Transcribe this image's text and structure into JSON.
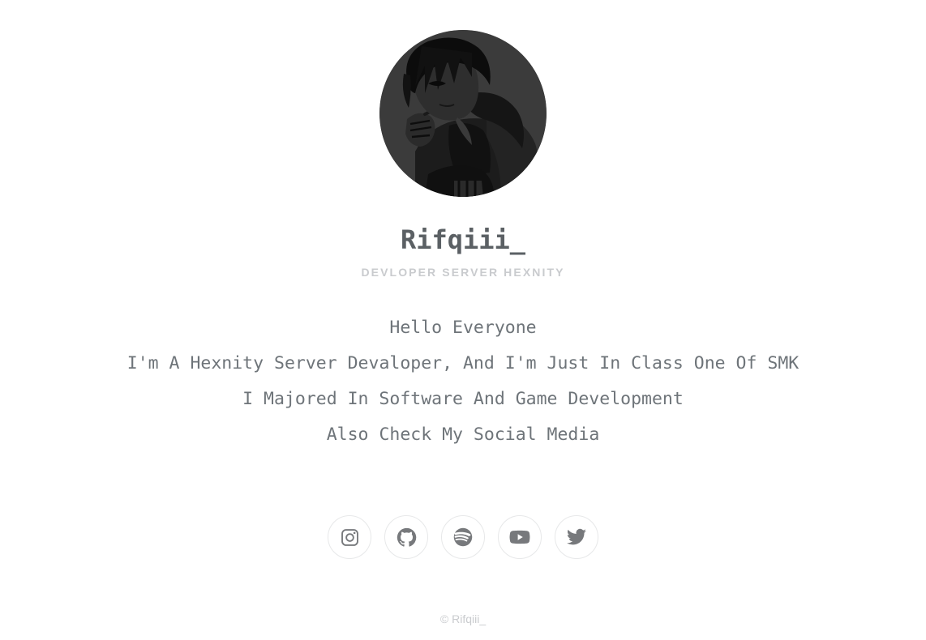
{
  "profile": {
    "avatar_alt": "avatar-anime-boy-dark",
    "name": "Rifqiii_",
    "subtitle": "DEVLOPER SERVER HEXNITY"
  },
  "bio": {
    "lines": [
      "Hello Everyone",
      "I'm A Hexnity Server Devaloper, And I'm Just In Class One Of SMK",
      "I Majored In Software And Game Development",
      "Also Check My Social Media"
    ]
  },
  "social": {
    "items": [
      {
        "name": "instagram",
        "label": "Instagram"
      },
      {
        "name": "github",
        "label": "GitHub"
      },
      {
        "name": "spotify",
        "label": "Spotify"
      },
      {
        "name": "youtube",
        "label": "YouTube"
      },
      {
        "name": "twitter",
        "label": "Twitter"
      }
    ]
  },
  "footer": {
    "copyright": "© Rifqiii_"
  },
  "colors": {
    "background": "#ffffff",
    "heading": "#5b6064",
    "subtitle": "#c9cbce",
    "body": "#6e7479",
    "icon": "#77797c",
    "icon_border": "#e7e8e9",
    "footer": "#c9cbce"
  }
}
